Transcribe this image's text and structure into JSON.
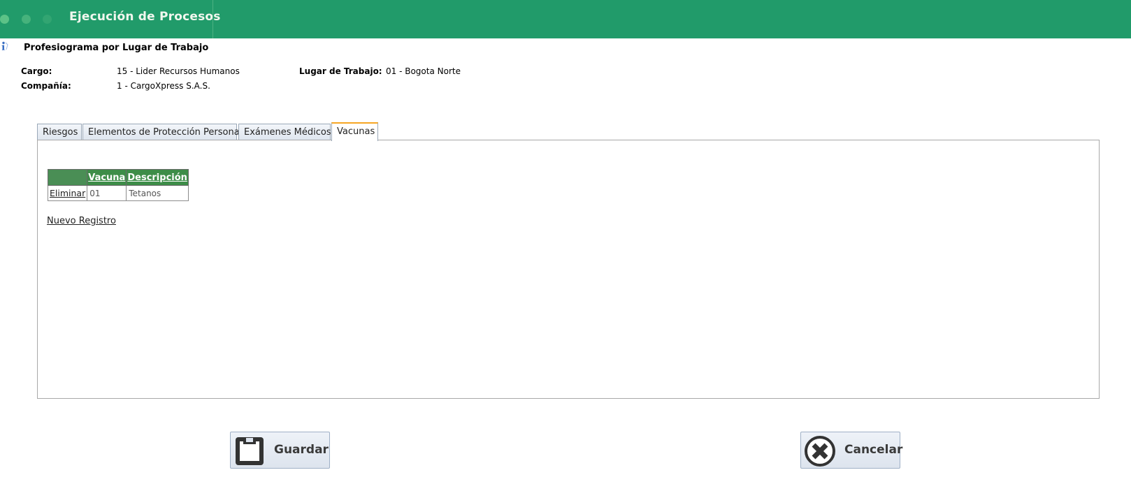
{
  "header": {
    "title": "Ejecución de Procesos"
  },
  "page": {
    "title": "Profesiograma por Lugar de Trabajo"
  },
  "fields": {
    "cargo_label": "Cargo:",
    "cargo_value": "15 - Lider Recursos Humanos",
    "lugar_label": "Lugar de Trabajo:",
    "lugar_value": "01 - Bogota Norte",
    "compania_label": "Compañía:",
    "compania_value": "1 - CargoXpress S.A.S."
  },
  "tabs": [
    {
      "label": "Riesgos",
      "active": false
    },
    {
      "label": "Elementos de Protección Personal",
      "active": false
    },
    {
      "label": "Exámenes Médicos",
      "active": false
    },
    {
      "label": "Vacunas",
      "active": true
    }
  ],
  "grid": {
    "columns": [
      "",
      "Vacuna",
      "Descripción"
    ],
    "rows": [
      {
        "action": "Eliminar",
        "vacuna": "01",
        "descripcion": "Tetanos"
      }
    ]
  },
  "new_record_label": "Nuevo Registro",
  "buttons": {
    "save": "Guardar",
    "cancel": "Cancelar"
  },
  "colors": {
    "header_bg": "#219b6a",
    "grid_header": "#3d8d48",
    "active_tab_accent": "#f6a623"
  },
  "icons": {
    "info": "info-icon",
    "save": "floppy-disk-icon",
    "cancel": "cancel-x-circle-icon"
  }
}
